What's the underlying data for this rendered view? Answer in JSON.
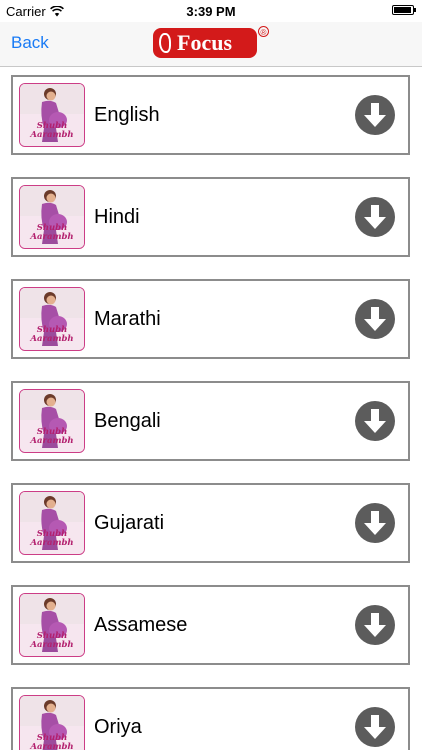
{
  "status_bar": {
    "carrier": "Carrier",
    "time": "3:39 PM"
  },
  "nav": {
    "back_label": "Back",
    "logo_text": "Focus",
    "registered_mark": "®"
  },
  "thumbnail_text": "Shubh Aarambh",
  "languages": [
    {
      "name": "English"
    },
    {
      "name": "Hindi"
    },
    {
      "name": "Marathi"
    },
    {
      "name": "Bengali"
    },
    {
      "name": "Gujarati"
    },
    {
      "name": "Assamese"
    },
    {
      "name": "Oriya"
    }
  ],
  "colors": {
    "accent": "#1a7bf5",
    "logo": "#d31a1a",
    "download_icon": "#5c5c5c",
    "item_border": "#8c8c8c"
  }
}
